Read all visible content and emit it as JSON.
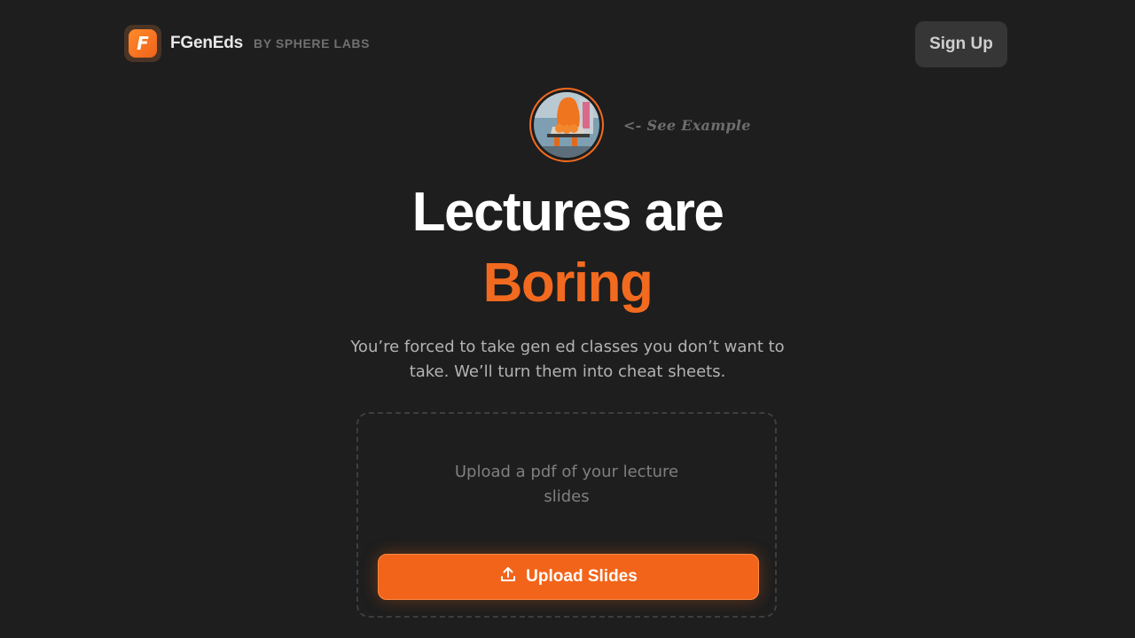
{
  "header": {
    "logo_letter": "F",
    "brand_name": "FGenEds",
    "brand_by": "BY SPHERE LABS",
    "signup_label": "Sign Up"
  },
  "example": {
    "link_label": "<- See Example"
  },
  "hero": {
    "line1": "Lectures are",
    "line2": "Boring",
    "subtitle": "You’re forced to take gen ed classes you don’t want to take. We’ll turn them into cheat sheets."
  },
  "upload": {
    "hint_line1": "Upload a pdf of your lecture",
    "hint_line2": "slides",
    "button_label": "Upload Slides",
    "button_icon": "upload-icon"
  },
  "colors": {
    "background": "#1e1e1e",
    "accent": "#f26a1f",
    "button": "#f26419",
    "signup_bg": "#363636"
  }
}
